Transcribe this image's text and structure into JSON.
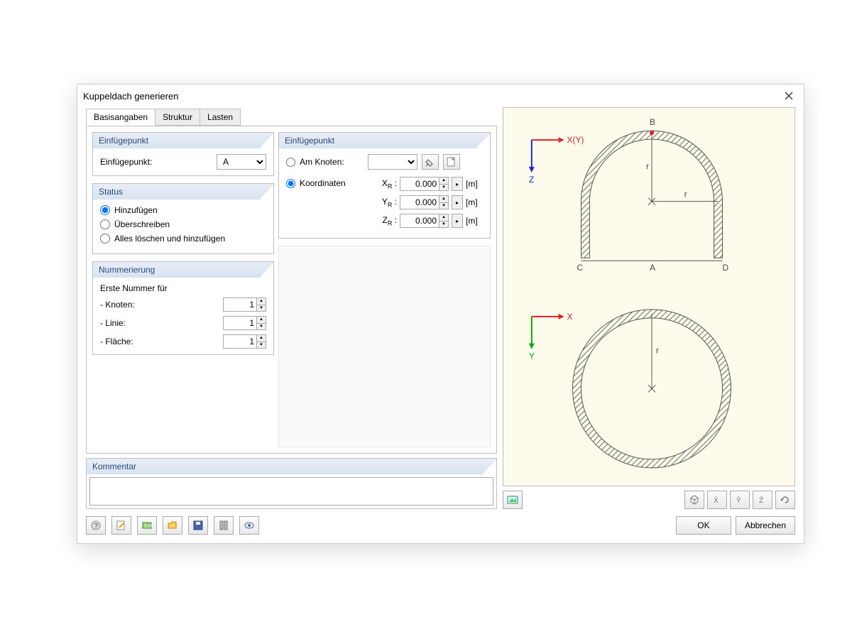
{
  "dialog": {
    "title": "Kuppeldach generieren"
  },
  "tabs": [
    {
      "label": "Basisangaben",
      "active": true
    },
    {
      "label": "Struktur",
      "active": false
    },
    {
      "label": "Lasten",
      "active": false
    }
  ],
  "insert_point_left": {
    "header": "Einfügepunkt",
    "label": "Einfügepunkt:",
    "value": "A",
    "options": [
      "A",
      "B",
      "C",
      "D"
    ]
  },
  "status": {
    "header": "Status",
    "options": [
      {
        "label": "Hinzufügen",
        "checked": true
      },
      {
        "label": "Überschreiben",
        "checked": false
      },
      {
        "label": "Alles löschen und hinzufügen",
        "checked": false
      }
    ]
  },
  "numbering": {
    "header": "Nummerierung",
    "subheader": "Erste Nummer für",
    "items": [
      {
        "label": "- Knoten:",
        "value": "1"
      },
      {
        "label": "- Linie:",
        "value": "1"
      },
      {
        "label": "- Fläche:",
        "value": "1"
      }
    ]
  },
  "insert_point_right": {
    "header": "Einfügepunkt",
    "mode_node_label": "Am Knoten:",
    "mode_coord_label": "Koordinaten",
    "mode_selected": "coord",
    "node_value": "",
    "coords": [
      {
        "label": "X",
        "sub": "R",
        "value": "0.000",
        "unit": "[m]"
      },
      {
        "label": "Y",
        "sub": "R",
        "value": "0.000",
        "unit": "[m]"
      },
      {
        "label": "Z",
        "sub": "R",
        "value": "0.000",
        "unit": "[m]"
      }
    ]
  },
  "comment": {
    "header": "Kommentar",
    "value": ""
  },
  "preview": {
    "axis_top": {
      "x": "X(Y)",
      "z": "Z"
    },
    "axis_bottom": {
      "x": "X",
      "y": "Y"
    },
    "labels": {
      "A": "A",
      "B": "B",
      "C": "C",
      "D": "D",
      "r": "r"
    }
  },
  "buttons": {
    "ok": "OK",
    "cancel": "Abbrechen"
  }
}
